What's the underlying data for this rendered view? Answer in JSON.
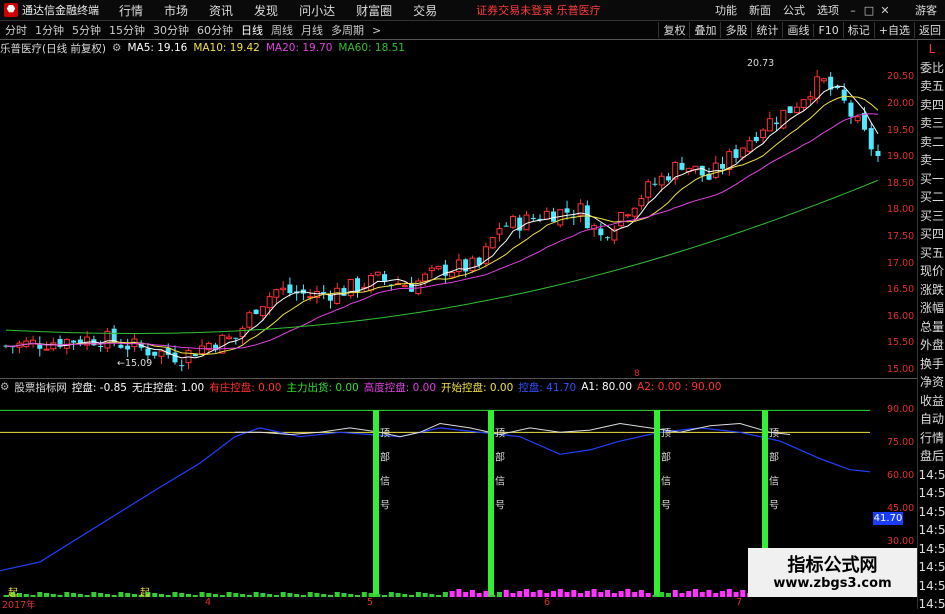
{
  "titlebar": {
    "app_title": "通达信金融终端",
    "menus": [
      "行情",
      "市场",
      "资讯",
      "发现",
      "问小达",
      "财富圈",
      "交易"
    ],
    "notice": "证券交易未登录  乐普医疗",
    "right_menus": [
      "功能",
      "新面",
      "公式",
      "选项"
    ],
    "guest": "游客"
  },
  "toolbar": {
    "periods": [
      "分时",
      "1分钟",
      "5分钟",
      "15分钟",
      "30分钟",
      "60分钟",
      "日线",
      "周线",
      "月线",
      "多周期"
    ],
    "active_period": "日线",
    "more": ">",
    "buttons": [
      "复权",
      "叠加",
      "多股",
      "统计",
      "画线",
      "F10",
      "标记",
      "+自选",
      "返回"
    ]
  },
  "main_info": {
    "stock": "乐普医疗(日线 前复权)",
    "ma5": "MA5: 19.16",
    "ma10": "MA10: 19.42",
    "ma20": "MA20: 19.70",
    "ma60": "MA60: 18.51"
  },
  "price_axis": [
    "20.50",
    "20.00",
    "19.50",
    "19.00",
    "18.50",
    "18.00",
    "17.50",
    "17.00",
    "16.50",
    "16.00",
    "15.50",
    "15.00"
  ],
  "annotations": {
    "high": "20.73",
    "low": "←15.09",
    "marker": "8"
  },
  "sub_info": {
    "name": "股票指标网",
    "kongpan": "控盘: -0.85",
    "wuzhuang": "无庄控盘: 1.00",
    "youzhuang": "有庄控盘: 0.00",
    "zhuli": "主力出货: 0.00",
    "gaodu": "高度控盘: 0.00",
    "kaishi": "开始控盘: 0.00",
    "blue": "控盘: 41.70",
    "a1": "A1: 80.00",
    "a2": "A2: 0.00 : 90.00"
  },
  "sub_axis": [
    "90.00",
    "75.00",
    "60.00",
    "45.00",
    "30.00",
    "15.00"
  ],
  "sub_current": "41.70",
  "signal_chars": [
    "顶",
    "部",
    "信",
    "号"
  ],
  "side_panel": [
    "L",
    "委比",
    "卖五",
    "卖四",
    "卖三",
    "卖二",
    "卖一",
    "买一",
    "买二",
    "买三",
    "买四",
    "买五",
    "现价",
    "涨跌",
    "涨幅",
    "总量",
    "外盘",
    "换手",
    "净资",
    "收益",
    "自动",
    "行情",
    "盘后",
    "14:5",
    "14:5",
    "14:5",
    "14:5",
    "14:5",
    "14:5",
    "14:5",
    "14:5"
  ],
  "dates": [
    "2017年",
    "4",
    "5",
    "6",
    "7"
  ],
  "watermark": {
    "title": "指标公式网",
    "url": "www.zbgs3.com"
  },
  "bottom_marks": [
    "起",
    "起"
  ],
  "colors": {
    "up": "#ff3030",
    "down": "#50e8ff",
    "ma5": "#ffffff",
    "ma10": "#f0e040",
    "ma20": "#e040e0",
    "ma60": "#30c030"
  }
}
